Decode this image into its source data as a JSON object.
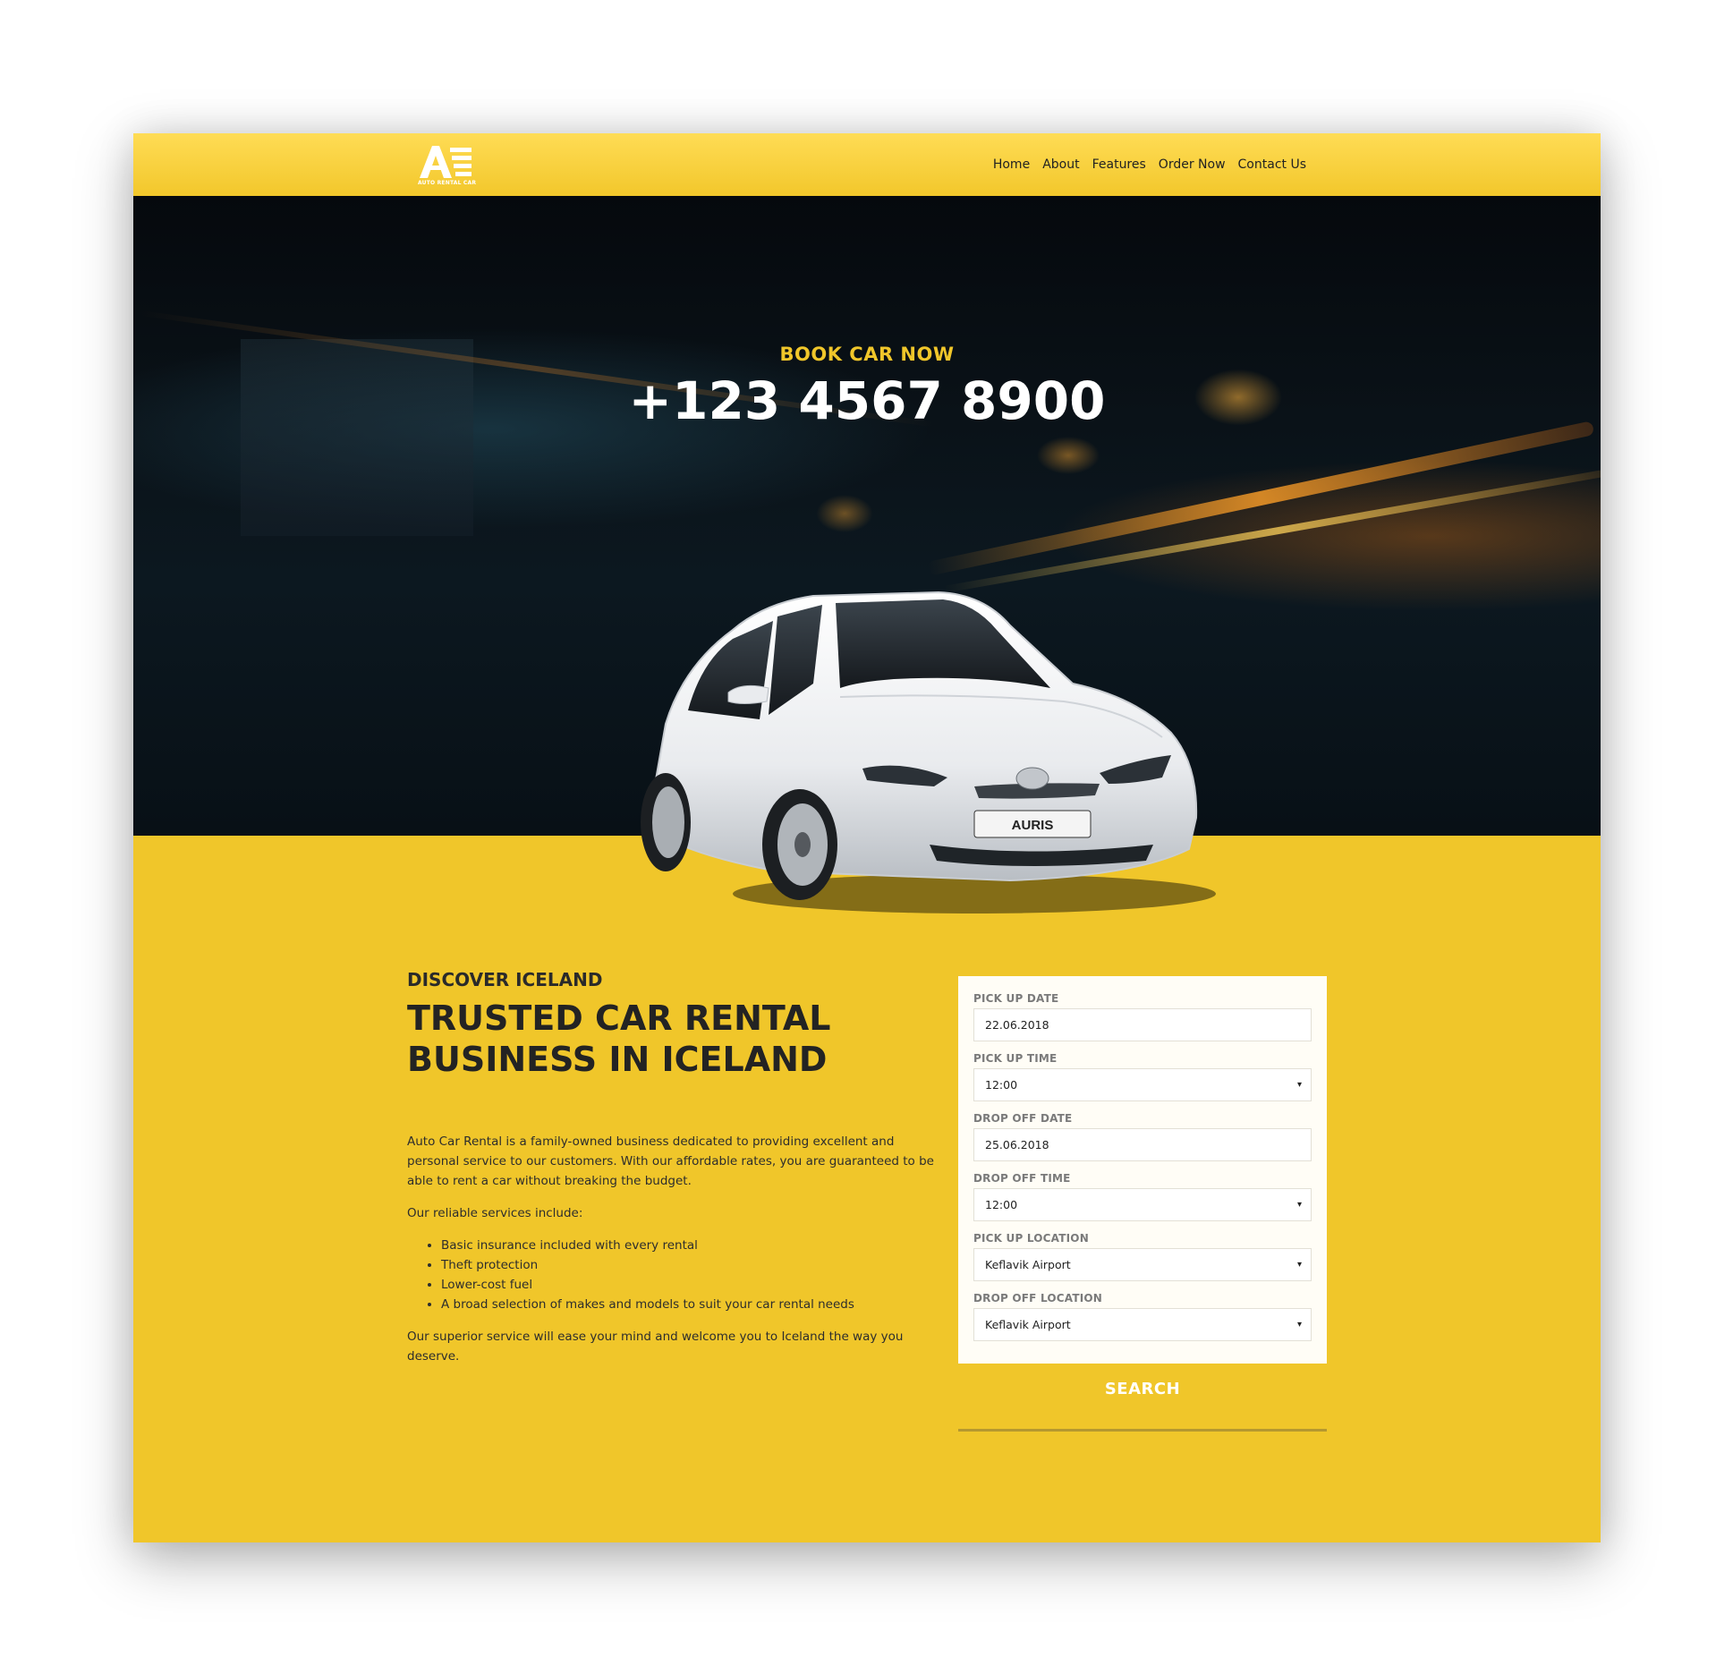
{
  "brand": {
    "logo_letter": "A",
    "logo_text": "AUTO RENTAL CAR"
  },
  "nav": [
    "Home",
    "About",
    "Features",
    "Order Now",
    "Contact Us"
  ],
  "hero": {
    "label": "BOOK CAR NOW",
    "phone": "+123 4567 8900",
    "plate": "AURIS"
  },
  "about": {
    "kicker": "DISCOVER ICELAND",
    "headline": "TRUSTED CAR RENTAL BUSINESS IN ICELAND",
    "intro": "Auto Car Rental is a family-owned business dedicated to providing excellent and personal service to our customers. With our affordable rates, you are guaranteed to be able to rent a car without breaking the budget.",
    "services_intro": "Our reliable services include:",
    "services": [
      "Basic insurance included with every rental",
      "Theft protection",
      "Lower-cost fuel",
      "A broad selection of makes and models to suit your car rental needs"
    ],
    "closing": "Our superior service will ease your mind and welcome you to Iceland the way you deserve."
  },
  "form": {
    "pickup_date_label": "PICK UP DATE",
    "pickup_date_value": "22.06.2018",
    "pickup_time_label": "PICK UP TIME",
    "pickup_time_value": "12:00",
    "dropoff_date_label": "DROP OFF DATE",
    "dropoff_date_value": "25.06.2018",
    "dropoff_time_label": "DROP OFF TIME",
    "dropoff_time_value": "12:00",
    "pickup_location_label": "PICK UP LOCATION",
    "pickup_location_value": "Keflavik Airport",
    "dropoff_location_label": "DROP OFF LOCATION",
    "dropoff_location_value": "Keflavik Airport",
    "caret": "▾",
    "search_label": "SEARCH"
  },
  "colors": {
    "accent": "#f0c62a",
    "header": "#ffdc55",
    "dark": "#0a1218"
  }
}
